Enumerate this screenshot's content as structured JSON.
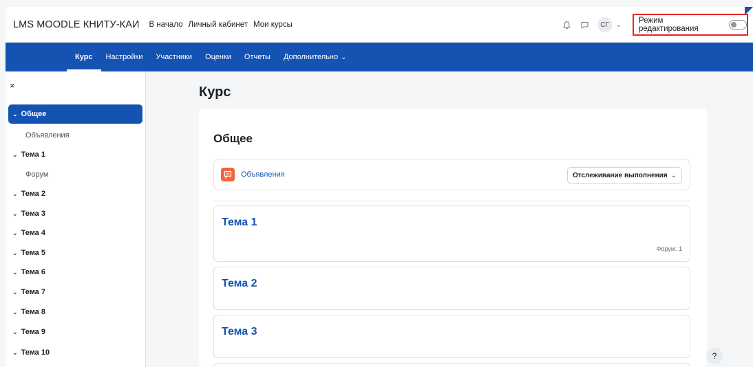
{
  "header": {
    "brand": "LMS MOODLE КНИТУ-КАИ",
    "links": [
      "В начало",
      "Личный кабинет",
      "Мои курсы"
    ],
    "avatar_initials": "СГ",
    "edit_mode_label": "Режим редактирования",
    "edit_mode_on": false
  },
  "secondary_nav": {
    "tabs": [
      "Курс",
      "Настройки",
      "Участники",
      "Оценки",
      "Отчеты",
      "Дополнительно"
    ],
    "more_chevron": "⌄",
    "active": "Курс"
  },
  "sidebar": {
    "close_glyph": "×",
    "items": [
      {
        "label": "Общее",
        "type": "section",
        "active": true
      },
      {
        "label": "Объявления",
        "type": "sub"
      },
      {
        "label": "Тема 1",
        "type": "section"
      },
      {
        "label": "Форум",
        "type": "sub"
      },
      {
        "label": "Тема 2",
        "type": "section"
      },
      {
        "label": "Тема 3",
        "type": "section"
      },
      {
        "label": "Тема 4",
        "type": "section"
      },
      {
        "label": "Тема 5",
        "type": "section"
      },
      {
        "label": "Тема 6",
        "type": "section"
      },
      {
        "label": "Тема 7",
        "type": "section"
      },
      {
        "label": "Тема 8",
        "type": "section"
      },
      {
        "label": "Тема 9",
        "type": "section"
      },
      {
        "label": "Тема 10",
        "type": "section"
      }
    ]
  },
  "main": {
    "page_title": "Курс",
    "section_title": "Общее",
    "activity": {
      "name": "Объявления",
      "icon": "forum-icon",
      "completion_button": "Отслеживание выполнения"
    },
    "topics": [
      {
        "title": "Тема 1",
        "meta": "Форум: 1"
      },
      {
        "title": "Тема 2",
        "meta": ""
      },
      {
        "title": "Тема 3",
        "meta": ""
      }
    ]
  },
  "help_label": "?",
  "colors": {
    "brand_blue": "#1553b3",
    "highlight_red": "#e3262d",
    "forum_orange": "#f0643b"
  }
}
